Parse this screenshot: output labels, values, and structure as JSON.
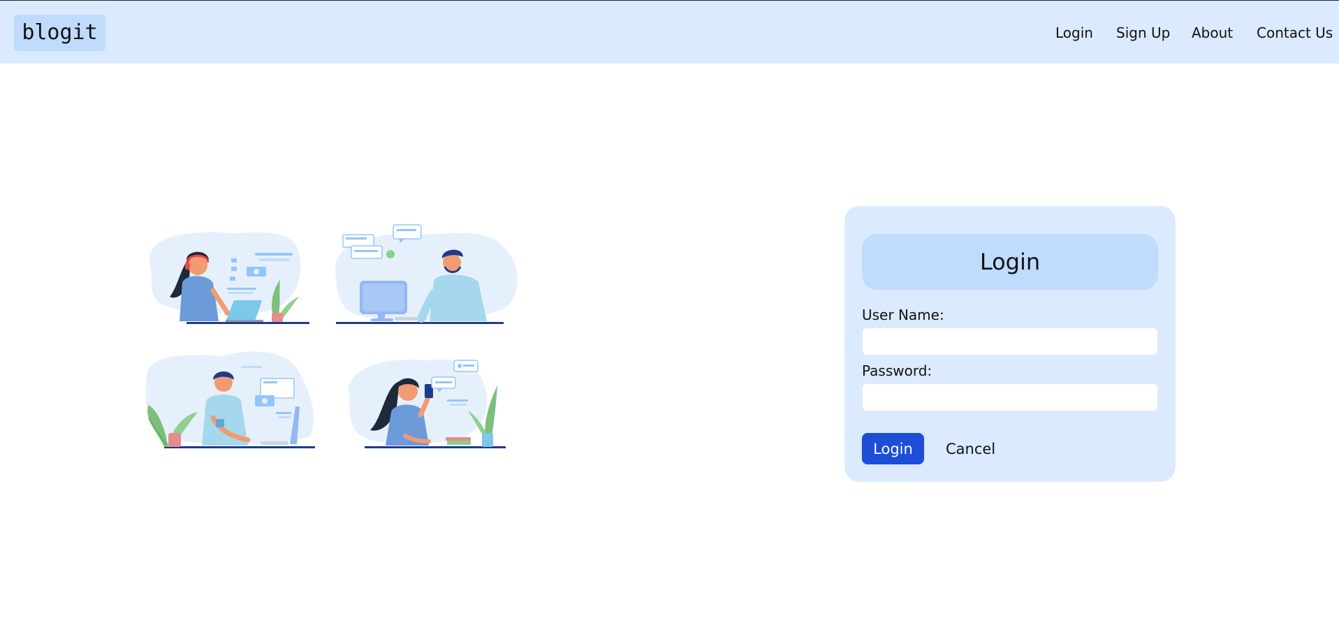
{
  "header": {
    "logo": "blogit",
    "nav": {
      "login": "Login",
      "signup": "Sign Up",
      "about": "About",
      "contact": "Contact Us"
    }
  },
  "illustrations": [
    {
      "icon": "woman-laptop-headphones-illustration"
    },
    {
      "icon": "man-desktop-computer-illustration"
    },
    {
      "icon": "man-monitor-coffee-illustration"
    },
    {
      "icon": "woman-phone-chat-illustration"
    }
  ],
  "login_form": {
    "title": "Login",
    "username_label": "User Name:",
    "username_value": "",
    "password_label": "Password:",
    "password_value": "",
    "submit_label": "Login",
    "cancel_label": "Cancel"
  },
  "colors": {
    "header_bg": "#dbeafe",
    "logo_bg": "#bfdbfe",
    "card_bg": "#dbeafe",
    "card_title_bg": "#bfdbfe",
    "primary_button": "#1d4ed8"
  }
}
